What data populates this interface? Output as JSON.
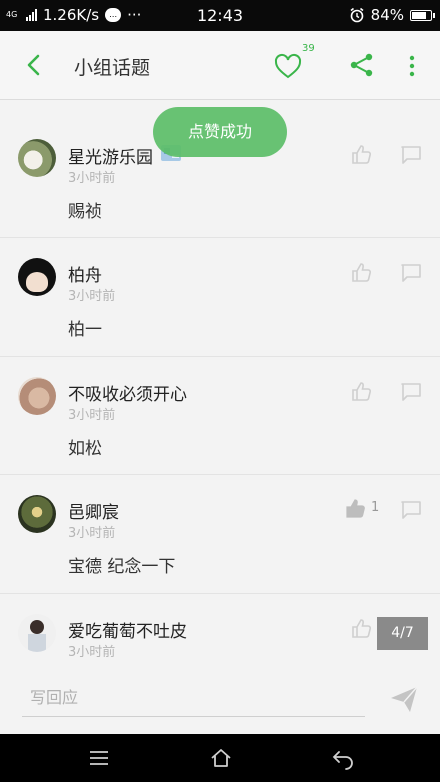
{
  "status_bar": {
    "network": "4G",
    "speed": "1.26K/s",
    "time": "12:43",
    "battery": "84%",
    "battery_level": 0.84
  },
  "header": {
    "title": "小组话题",
    "like_count": "39"
  },
  "toast": "点赞成功",
  "comments": [
    {
      "name": "星光游乐园",
      "time": "3小时前",
      "text": "赐祯",
      "likes": ""
    },
    {
      "name": "柏舟",
      "time": "3小时前",
      "text": "柏一",
      "likes": ""
    },
    {
      "name": "不吸收必须开心",
      "time": "3小时前",
      "text": "如松",
      "likes": ""
    },
    {
      "name": "邑卿宸",
      "time": "3小时前",
      "text": "宝德 纪念一下",
      "likes": "1"
    },
    {
      "name": "爱吃葡萄不吐皮",
      "time": "3小时前",
      "text": "",
      "likes": ""
    }
  ],
  "pager": "4/7",
  "input": {
    "placeholder": "写回应"
  },
  "colors": {
    "accent": "#3ab54a",
    "toast_bg": "#5cbe68"
  }
}
